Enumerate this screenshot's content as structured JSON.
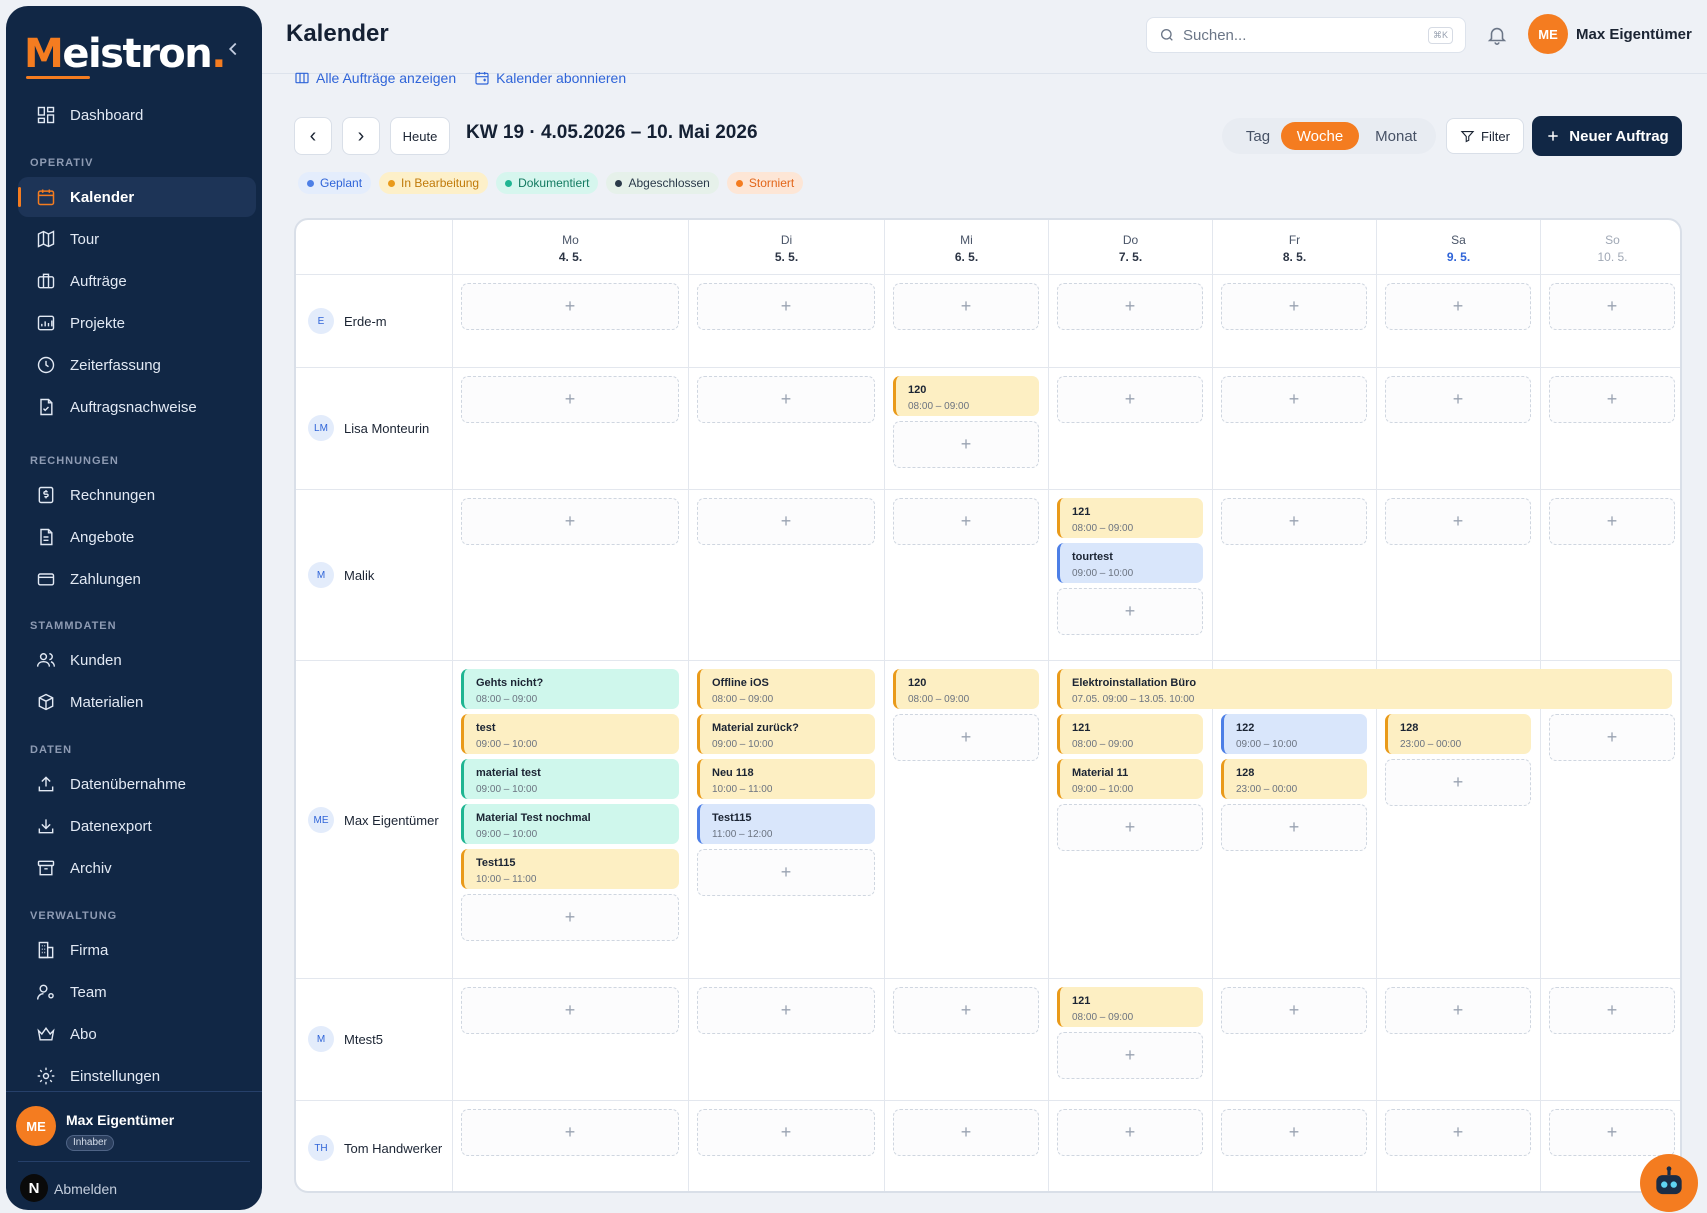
{
  "sidebar": {
    "logo_first": "M",
    "logo_rest": "eistron",
    "logo_dot": ".",
    "items": {
      "dashboard": "Dashboard",
      "kalender": "Kalender",
      "tour": "Tour",
      "auftraege": "Aufträge",
      "projekte": "Projekte",
      "zeiterfassung": "Zeiterfassung",
      "auftragsnachweise": "Auftragsnachweise",
      "rechnungen": "Rechnungen",
      "angebote": "Angebote",
      "zahlungen": "Zahlungen",
      "kunden": "Kunden",
      "materialien": "Materialien",
      "datenuebernahme": "Datenübernahme",
      "datenexport": "Datenexport",
      "archiv": "Archiv",
      "firma": "Firma",
      "team": "Team",
      "abo": "Abo",
      "einstellungen": "Einstellungen"
    },
    "sections": {
      "operativ": "OPERATIV",
      "rechnungen": "RECHNUNGEN",
      "stammdaten": "STAMMDATEN",
      "daten": "DATEN",
      "verwaltung": "VERWALTUNG"
    },
    "user": {
      "initials": "ME",
      "name": "Max Eigentümer",
      "role": "Inhaber"
    },
    "logout": "Abmelden",
    "logout_badge": "N"
  },
  "header": {
    "title": "Kalender",
    "search_placeholder": "Suchen...",
    "search_shortcut": "⌘K",
    "user_initials": "ME",
    "user_name": "Max Eigentümer"
  },
  "links": {
    "all_orders": "Alle Aufträge anzeigen",
    "subscribe": "Kalender abonnieren"
  },
  "toolbar": {
    "prev": "‹",
    "next": "›",
    "today": "Heute",
    "week_title": "KW 19 · 4.05.2026 – 10. Mai 2026",
    "views": [
      "Tag",
      "Woche",
      "Monat"
    ],
    "active_view": "Woche",
    "filter": "Filter",
    "new_order": "Neuer Auftrag"
  },
  "legend": [
    {
      "label": "Geplant",
      "color": "#4d7fe6",
      "bg": "#e4edfc",
      "fg": "#2f64d8"
    },
    {
      "label": "In Bearbeitung",
      "color": "#e99a1a",
      "bg": "#fdf0c9",
      "fg": "#c07a0a"
    },
    {
      "label": "Dokumentiert",
      "color": "#1fb592",
      "bg": "#d6f6ee",
      "fg": "#137a61"
    },
    {
      "label": "Abgeschlossen",
      "color": "#2b3a4a",
      "bg": "#e6f1ea",
      "fg": "#2b3a4a"
    },
    {
      "label": "Storniert",
      "color": "#f47c20",
      "bg": "#fde6d6",
      "fg": "#e2661a"
    }
  ],
  "days": [
    {
      "name": "Mo",
      "date": "4. 5."
    },
    {
      "name": "Di",
      "date": "5. 5."
    },
    {
      "name": "Mi",
      "date": "6. 5."
    },
    {
      "name": "Do",
      "date": "7. 5."
    },
    {
      "name": "Fr",
      "date": "8. 5."
    },
    {
      "name": "Sa",
      "date": "9. 5."
    },
    {
      "name": "So",
      "date": "10. 5."
    }
  ],
  "colors": {
    "weekend_sa": "#2f64d8",
    "weekend_so": "#a0a8b5",
    "accent": "#f47c20",
    "navy": "#112745"
  },
  "employees": [
    {
      "initials": "E",
      "name": "Erde-m"
    },
    {
      "initials": "LM",
      "name": "Lisa Monteurin"
    },
    {
      "initials": "M",
      "name": "Malik"
    },
    {
      "initials": "ME",
      "name": "Max Eigentümer"
    },
    {
      "initials": "M",
      "name": "Mtest5"
    },
    {
      "initials": "TH",
      "name": "Tom Handwerker"
    }
  ],
  "slot_add": "+",
  "events": {
    "lisa_mi": {
      "title": "120",
      "time": "08:00 – 09:00",
      "status": "In Bearbeitung"
    },
    "malik_do_1": {
      "title": "121",
      "time": "08:00 – 09:00",
      "status": "In Bearbeitung"
    },
    "malik_do_2": {
      "title": "tourtest",
      "time": "09:00 – 10:00",
      "status": "Geplant"
    },
    "max_mo_1": {
      "title": "Gehts nicht?",
      "time": "08:00 – 09:00",
      "status": "Dokumentiert"
    },
    "max_mo_2": {
      "title": "test",
      "time": "09:00 – 10:00",
      "status": "In Bearbeitung"
    },
    "max_mo_3": {
      "title": "material test",
      "time": "09:00 – 10:00",
      "status": "Dokumentiert"
    },
    "max_mo_4": {
      "title": "Material Test nochmal",
      "time": "09:00 – 10:00",
      "status": "Dokumentiert"
    },
    "max_mo_5": {
      "title": "Test115",
      "time": "10:00 – 11:00",
      "status": "In Bearbeitung"
    },
    "max_di_1": {
      "title": "Offline iOS",
      "time": "08:00 – 09:00",
      "status": "In Bearbeitung"
    },
    "max_di_2": {
      "title": "Material zurück?",
      "time": "09:00 – 10:00",
      "status": "In Bearbeitung"
    },
    "max_di_3": {
      "title": "Neu 118",
      "time": "10:00 – 11:00",
      "status": "In Bearbeitung"
    },
    "max_di_4": {
      "title": "Test115",
      "time": "11:00 – 12:00",
      "status": "Geplant"
    },
    "max_mi_1": {
      "title": "120",
      "time": "08:00 – 09:00",
      "status": "In Bearbeitung"
    },
    "max_span": {
      "title": "Elektroinstallation Büro",
      "time": "07.05. 09:00 – 13.05. 10:00",
      "status": "In Bearbeitung"
    },
    "max_do_1": {
      "title": "121",
      "time": "08:00 – 09:00",
      "status": "In Bearbeitung"
    },
    "max_do_2": {
      "title": "Material 11",
      "time": "09:00 – 10:00",
      "status": "In Bearbeitung"
    },
    "max_fr_1": {
      "title": "122",
      "time": "09:00 – 10:00",
      "status": "Geplant"
    },
    "max_fr_2": {
      "title": "128",
      "time": "23:00 – 00:00",
      "status": "In Bearbeitung"
    },
    "max_sa_1": {
      "title": "128",
      "time": "23:00 – 00:00",
      "status": "In Bearbeitung"
    },
    "mtest_do": {
      "title": "121",
      "time": "08:00 – 09:00",
      "status": "In Bearbeitung"
    }
  },
  "icons": [
    "collapse-chevron-icon",
    "dashboard-icon",
    "calendar-icon",
    "map-icon",
    "briefcase-icon",
    "chart-icon",
    "clock-icon",
    "document-check-icon",
    "dollar-icon",
    "document-icon",
    "credit-card-icon",
    "users-icon",
    "box-icon",
    "upload-icon",
    "download-icon",
    "archive-icon",
    "building-icon",
    "user-cog-icon",
    "crown-icon",
    "gear-icon",
    "search-icon",
    "bell-icon",
    "columns-icon",
    "calendar-sync-icon",
    "filter-icon",
    "plus-icon",
    "robot-icon"
  ]
}
